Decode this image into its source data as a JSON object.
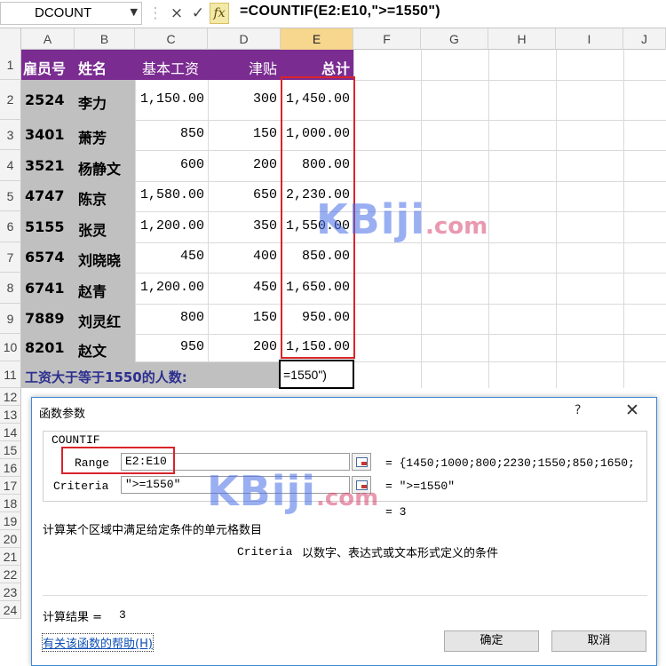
{
  "formula_bar": {
    "name_box": "DCOUNT",
    "cancel_icon": "×",
    "enter_icon": "✓",
    "fx": "fx",
    "formula": "=COUNTIF(E2:E10,\">=1550\")"
  },
  "columns": [
    "A",
    "B",
    "C",
    "D",
    "E",
    "F",
    "G",
    "H",
    "I",
    "J"
  ],
  "rows": [
    "1",
    "2",
    "3",
    "4",
    "5",
    "6",
    "7",
    "8",
    "9",
    "10",
    "11",
    "12",
    "13",
    "14",
    "15",
    "16",
    "17",
    "18",
    "19",
    "20",
    "21",
    "22",
    "23",
    "24"
  ],
  "header": {
    "emp_id": "雇员号",
    "name": "姓名",
    "base_salary": "基本工资",
    "allowance": "津贴",
    "total": "总计"
  },
  "table": [
    {
      "id": "2524",
      "name": "李力",
      "base": "1,150.00",
      "allow": "300",
      "total": "1,450.00"
    },
    {
      "id": "3401",
      "name": "萧芳",
      "base": "850",
      "allow": "150",
      "total": "1,000.00"
    },
    {
      "id": "3521",
      "name": "杨静文",
      "base": "600",
      "allow": "200",
      "total": "800.00"
    },
    {
      "id": "4747",
      "name": "陈京",
      "base": "1,580.00",
      "allow": "650",
      "total": "2,230.00"
    },
    {
      "id": "5155",
      "name": "张灵",
      "base": "1,200.00",
      "allow": "350",
      "total": "1,550.00"
    },
    {
      "id": "6574",
      "name": "刘晓晓",
      "base": "450",
      "allow": "400",
      "total": "850.00"
    },
    {
      "id": "6741",
      "name": "赵青",
      "base": "1,200.00",
      "allow": "450",
      "total": "1,650.00"
    },
    {
      "id": "7889",
      "name": "刘灵红",
      "base": "800",
      "allow": "150",
      "total": "950.00"
    },
    {
      "id": "8201",
      "name": "赵文",
      "base": "950",
      "allow": "200",
      "total": "1,150.00"
    }
  ],
  "row11": {
    "label": "工资大于等于1550的人数:",
    "edit_value": "=1550\")"
  },
  "dialog": {
    "title": "函数参数",
    "help_q": "?",
    "close": "✕",
    "function_name": "COUNTIF",
    "range_label": "Range",
    "range_value": "E2:E10",
    "range_eval": "= {1450;1000;800;2230;1550;850;1650;",
    "criteria_label": "Criteria",
    "criteria_value": "\">=1550\"",
    "criteria_eval": "= \">=1550\"",
    "result_eval": "= 3",
    "description": "计算某个区域中满足给定条件的单元格数目",
    "arg_desc_name": "Criteria",
    "arg_desc": "以数字、表达式或文本形式定义的条件",
    "result_label": "计算结果 =",
    "result_value": "3",
    "help_link": "有关该函数的帮助(H)",
    "ok": "确定",
    "cancel": "取消"
  },
  "watermark": {
    "main": "KBiji",
    "suffix": ".com"
  },
  "colors": {
    "header_purple": "#7b2c91",
    "id_name_gray": "#c0c0c0",
    "label_blue": "#2c2f8f",
    "highlight_red": "#d9242a",
    "selected_col": "#f7d68e"
  }
}
